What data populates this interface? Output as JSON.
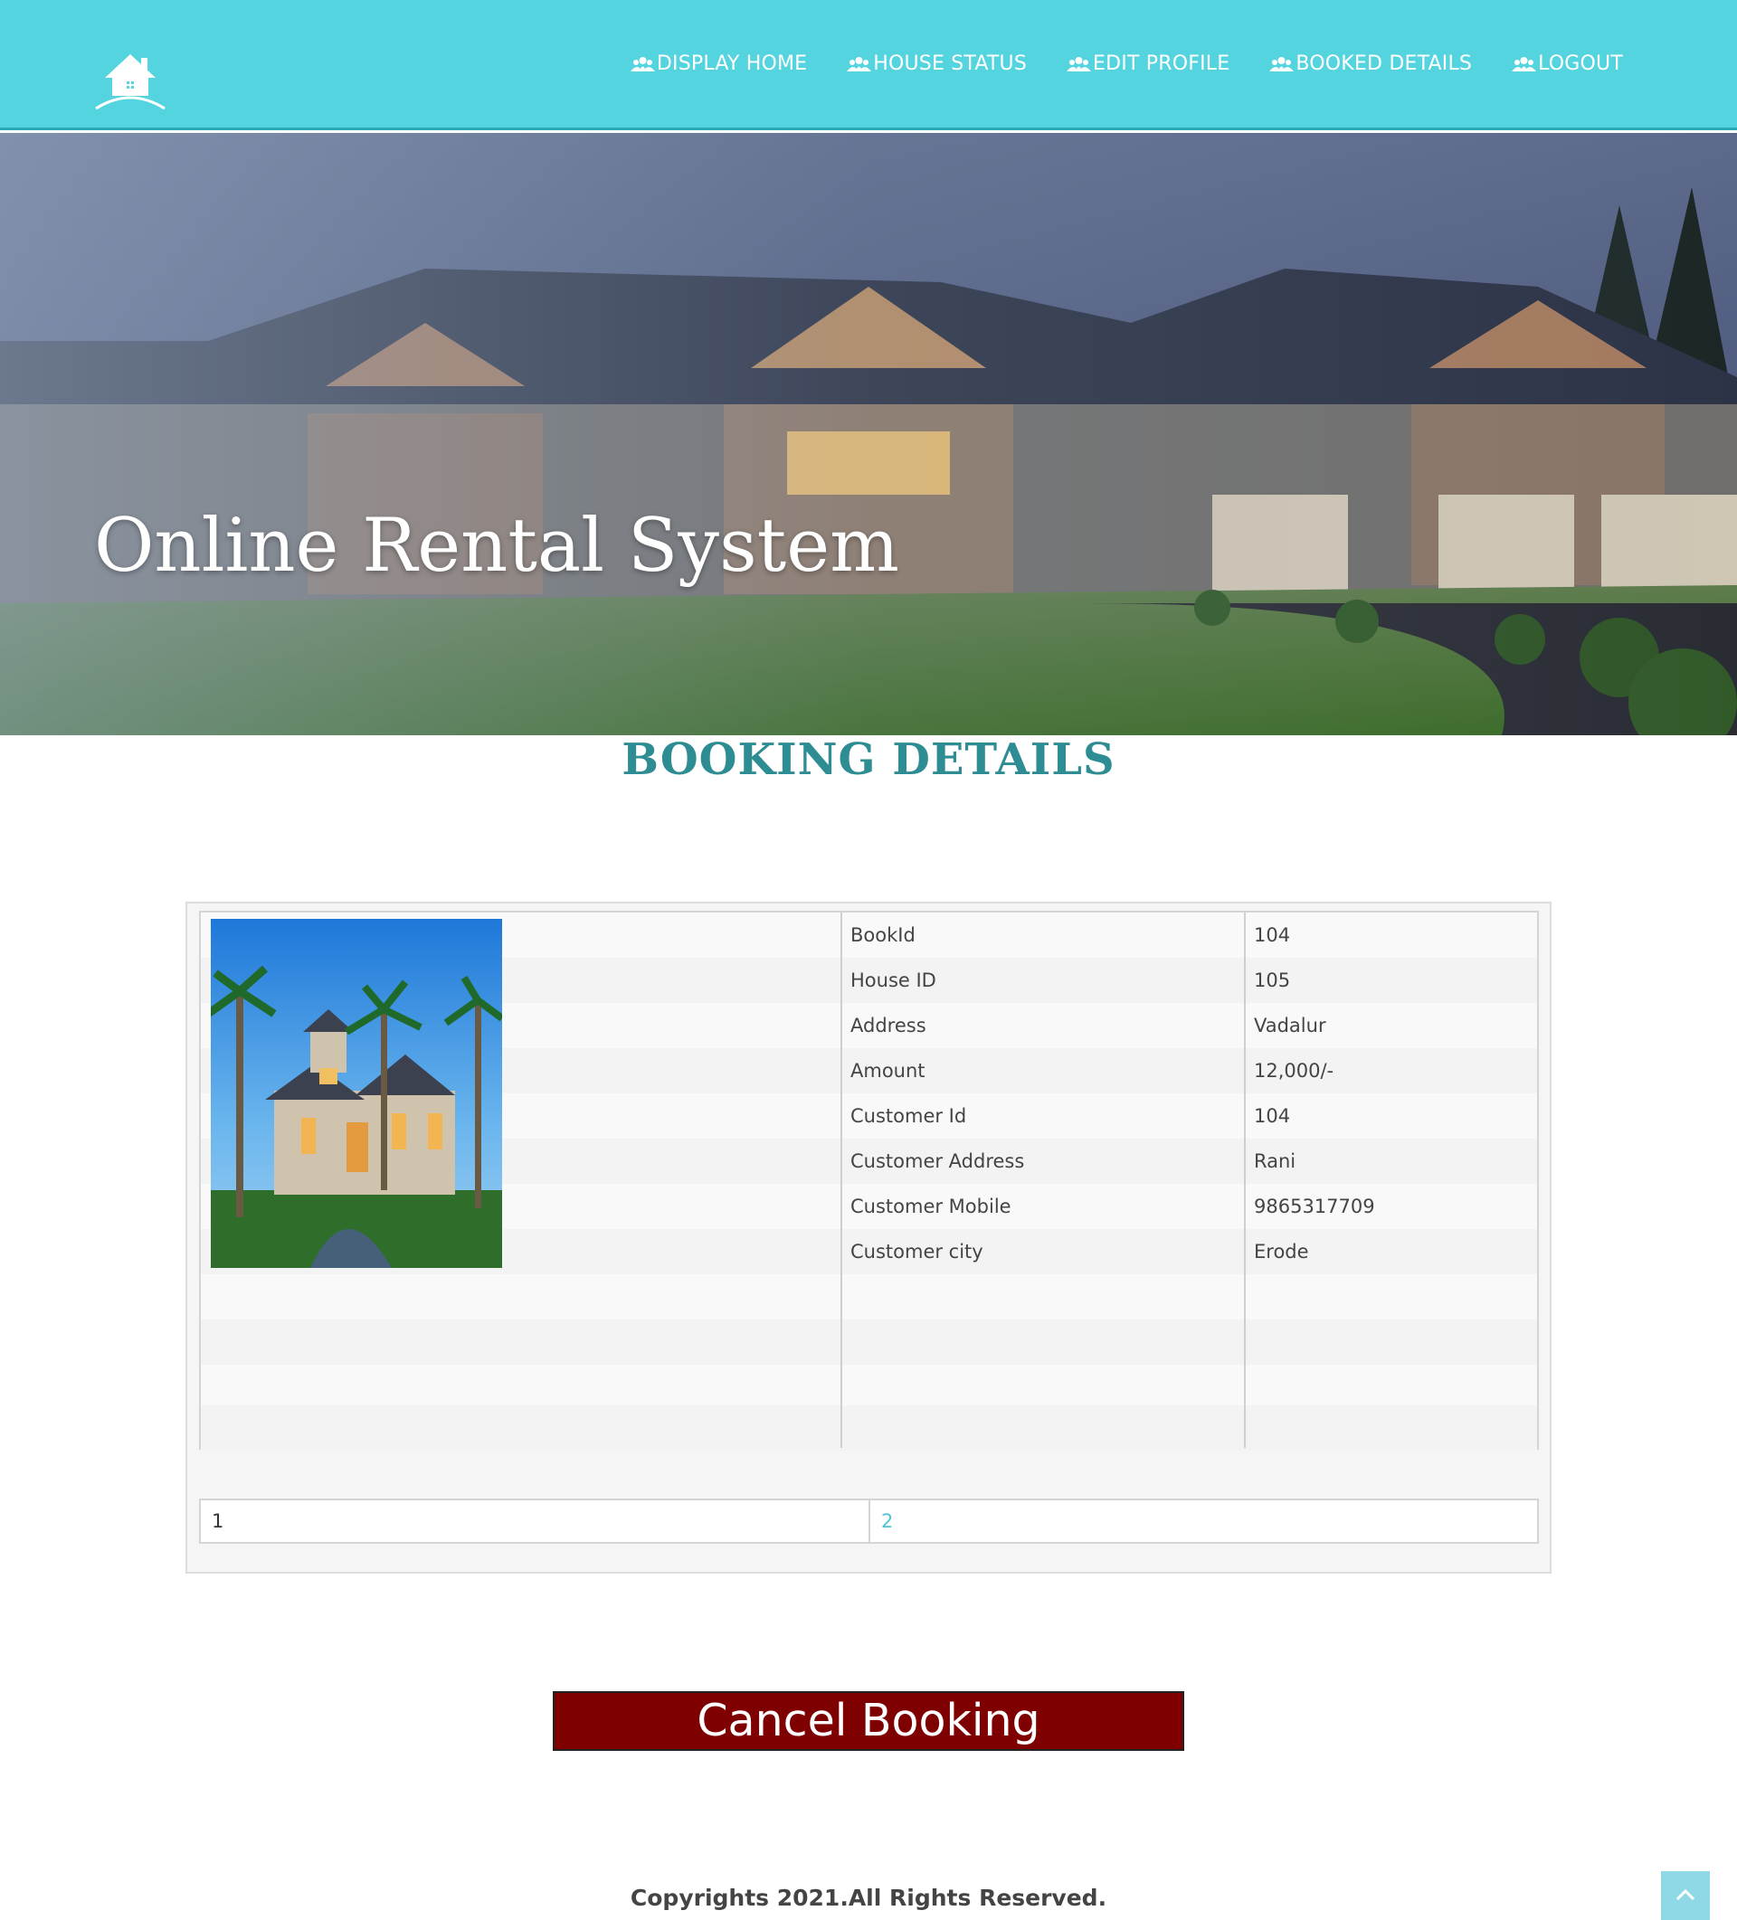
{
  "nav": {
    "items": [
      {
        "label": "DISPLAY HOME",
        "icon": "users-icon"
      },
      {
        "label": "HOUSE STATUS",
        "icon": "users-icon"
      },
      {
        "label": "EDIT PROFILE",
        "icon": "users-icon"
      },
      {
        "label": "BOOKED DETAILS",
        "icon": "users-icon"
      },
      {
        "label": "LOGOUT",
        "icon": "users-icon"
      }
    ]
  },
  "hero": {
    "title": "Online Rental System"
  },
  "section": {
    "title": "BOOKING DETAILS"
  },
  "booking": {
    "fields": [
      {
        "label": "BookId",
        "value": "104"
      },
      {
        "label": "House ID",
        "value": "105"
      },
      {
        "label": "Address",
        "value": "Vadalur"
      },
      {
        "label": "Amount",
        "value": "12,000/-"
      },
      {
        "label": "Customer Id",
        "value": "104"
      },
      {
        "label": "Customer Address",
        "value": "Rani"
      },
      {
        "label": "Customer Mobile",
        "value": "9865317709"
      },
      {
        "label": "Customer city",
        "value": "Erode"
      }
    ]
  },
  "pagination": {
    "pages": [
      "1",
      "2"
    ]
  },
  "actions": {
    "cancel_label": "Cancel Booking"
  },
  "footer": {
    "text": "Copyrights 2021.All Rights Reserved."
  },
  "colors": {
    "header": "#54d4df",
    "title_teal": "#2e8c93",
    "cancel_red": "#7f0000",
    "link": "#4fc4d6"
  }
}
